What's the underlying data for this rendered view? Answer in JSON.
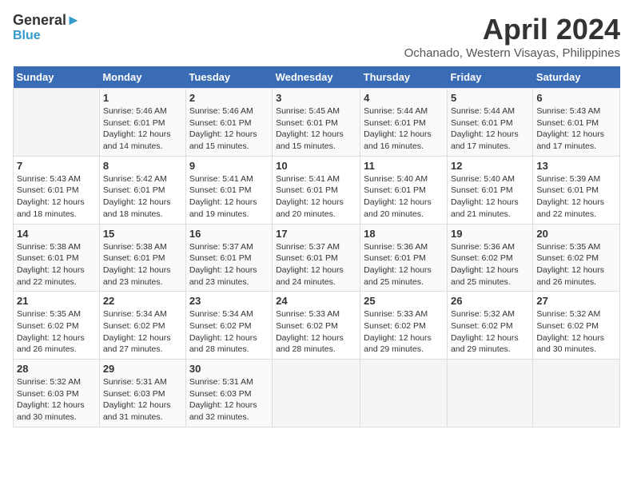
{
  "logo": {
    "line1": "General",
    "line2": "Blue"
  },
  "title": "April 2024",
  "subtitle": "Ochanado, Western Visayas, Philippines",
  "days_header": [
    "Sunday",
    "Monday",
    "Tuesday",
    "Wednesday",
    "Thursday",
    "Friday",
    "Saturday"
  ],
  "weeks": [
    [
      {
        "day": "",
        "info": ""
      },
      {
        "day": "1",
        "info": "Sunrise: 5:46 AM\nSunset: 6:01 PM\nDaylight: 12 hours\nand 14 minutes."
      },
      {
        "day": "2",
        "info": "Sunrise: 5:46 AM\nSunset: 6:01 PM\nDaylight: 12 hours\nand 15 minutes."
      },
      {
        "day": "3",
        "info": "Sunrise: 5:45 AM\nSunset: 6:01 PM\nDaylight: 12 hours\nand 15 minutes."
      },
      {
        "day": "4",
        "info": "Sunrise: 5:44 AM\nSunset: 6:01 PM\nDaylight: 12 hours\nand 16 minutes."
      },
      {
        "day": "5",
        "info": "Sunrise: 5:44 AM\nSunset: 6:01 PM\nDaylight: 12 hours\nand 17 minutes."
      },
      {
        "day": "6",
        "info": "Sunrise: 5:43 AM\nSunset: 6:01 PM\nDaylight: 12 hours\nand 17 minutes."
      }
    ],
    [
      {
        "day": "7",
        "info": "Sunrise: 5:43 AM\nSunset: 6:01 PM\nDaylight: 12 hours\nand 18 minutes."
      },
      {
        "day": "8",
        "info": "Sunrise: 5:42 AM\nSunset: 6:01 PM\nDaylight: 12 hours\nand 18 minutes."
      },
      {
        "day": "9",
        "info": "Sunrise: 5:41 AM\nSunset: 6:01 PM\nDaylight: 12 hours\nand 19 minutes."
      },
      {
        "day": "10",
        "info": "Sunrise: 5:41 AM\nSunset: 6:01 PM\nDaylight: 12 hours\nand 20 minutes."
      },
      {
        "day": "11",
        "info": "Sunrise: 5:40 AM\nSunset: 6:01 PM\nDaylight: 12 hours\nand 20 minutes."
      },
      {
        "day": "12",
        "info": "Sunrise: 5:40 AM\nSunset: 6:01 PM\nDaylight: 12 hours\nand 21 minutes."
      },
      {
        "day": "13",
        "info": "Sunrise: 5:39 AM\nSunset: 6:01 PM\nDaylight: 12 hours\nand 22 minutes."
      }
    ],
    [
      {
        "day": "14",
        "info": "Sunrise: 5:38 AM\nSunset: 6:01 PM\nDaylight: 12 hours\nand 22 minutes."
      },
      {
        "day": "15",
        "info": "Sunrise: 5:38 AM\nSunset: 6:01 PM\nDaylight: 12 hours\nand 23 minutes."
      },
      {
        "day": "16",
        "info": "Sunrise: 5:37 AM\nSunset: 6:01 PM\nDaylight: 12 hours\nand 23 minutes."
      },
      {
        "day": "17",
        "info": "Sunrise: 5:37 AM\nSunset: 6:01 PM\nDaylight: 12 hours\nand 24 minutes."
      },
      {
        "day": "18",
        "info": "Sunrise: 5:36 AM\nSunset: 6:01 PM\nDaylight: 12 hours\nand 25 minutes."
      },
      {
        "day": "19",
        "info": "Sunrise: 5:36 AM\nSunset: 6:02 PM\nDaylight: 12 hours\nand 25 minutes."
      },
      {
        "day": "20",
        "info": "Sunrise: 5:35 AM\nSunset: 6:02 PM\nDaylight: 12 hours\nand 26 minutes."
      }
    ],
    [
      {
        "day": "21",
        "info": "Sunrise: 5:35 AM\nSunset: 6:02 PM\nDaylight: 12 hours\nand 26 minutes."
      },
      {
        "day": "22",
        "info": "Sunrise: 5:34 AM\nSunset: 6:02 PM\nDaylight: 12 hours\nand 27 minutes."
      },
      {
        "day": "23",
        "info": "Sunrise: 5:34 AM\nSunset: 6:02 PM\nDaylight: 12 hours\nand 28 minutes."
      },
      {
        "day": "24",
        "info": "Sunrise: 5:33 AM\nSunset: 6:02 PM\nDaylight: 12 hours\nand 28 minutes."
      },
      {
        "day": "25",
        "info": "Sunrise: 5:33 AM\nSunset: 6:02 PM\nDaylight: 12 hours\nand 29 minutes."
      },
      {
        "day": "26",
        "info": "Sunrise: 5:32 AM\nSunset: 6:02 PM\nDaylight: 12 hours\nand 29 minutes."
      },
      {
        "day": "27",
        "info": "Sunrise: 5:32 AM\nSunset: 6:02 PM\nDaylight: 12 hours\nand 30 minutes."
      }
    ],
    [
      {
        "day": "28",
        "info": "Sunrise: 5:32 AM\nSunset: 6:03 PM\nDaylight: 12 hours\nand 30 minutes."
      },
      {
        "day": "29",
        "info": "Sunrise: 5:31 AM\nSunset: 6:03 PM\nDaylight: 12 hours\nand 31 minutes."
      },
      {
        "day": "30",
        "info": "Sunrise: 5:31 AM\nSunset: 6:03 PM\nDaylight: 12 hours\nand 32 minutes."
      },
      {
        "day": "",
        "info": ""
      },
      {
        "day": "",
        "info": ""
      },
      {
        "day": "",
        "info": ""
      },
      {
        "day": "",
        "info": ""
      }
    ]
  ]
}
